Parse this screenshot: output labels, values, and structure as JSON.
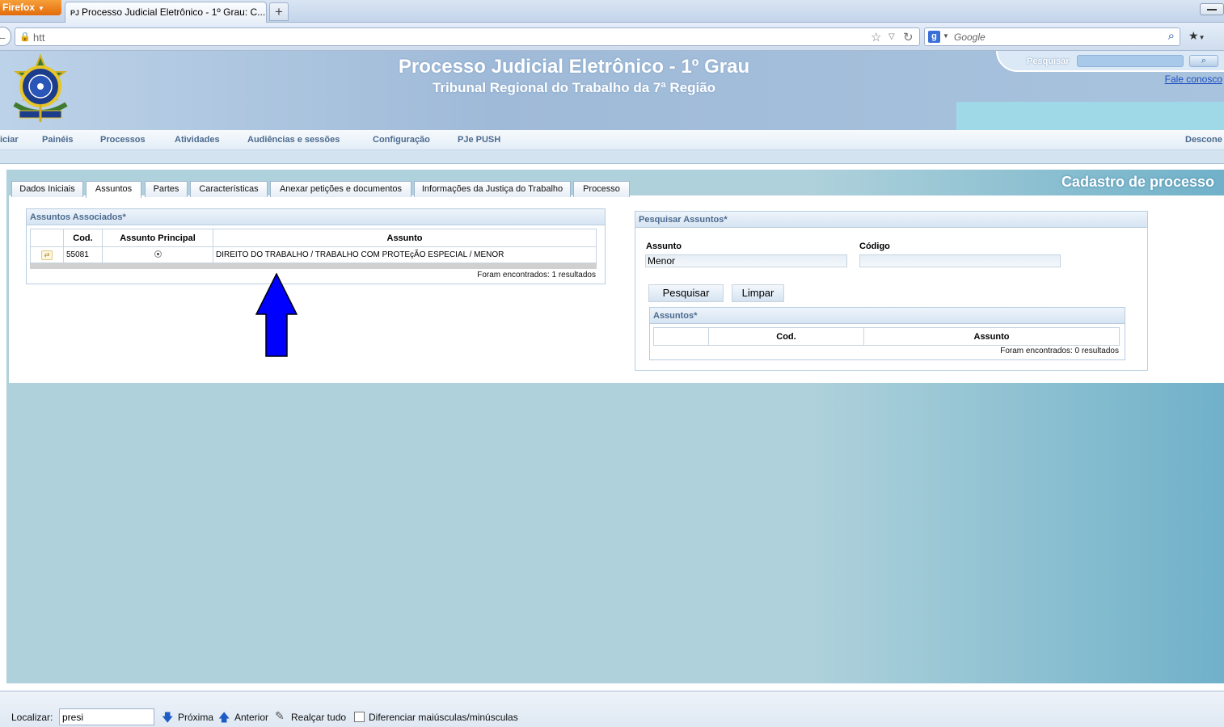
{
  "browser": {
    "app_button": "Firefox",
    "tab_title": "Processo Judicial Eletrônico - 1º Grau: C...",
    "tab_favicon": "PJ",
    "url": "htt",
    "search_placeholder": "Google"
  },
  "header": {
    "title": "Processo Judicial Eletrônico - 1º Grau",
    "subtitle": "Tribunal Regional do Trabalho da 7ª Região",
    "search_label": "Pesquisar",
    "contact_link": "Fale conosco"
  },
  "menu": {
    "items": [
      "iciar",
      "Painéis",
      "Processos",
      "Atividades",
      "Audiências e sessões",
      "Configuração",
      "PJe PUSH"
    ],
    "right_item": "Descone"
  },
  "page": {
    "heading": "Cadastro de processo",
    "tabs": [
      "Dados Iniciais",
      "Assuntos",
      "Partes",
      "Características",
      "Anexar petições e documentos",
      "Informações da Justiça do Trabalho",
      "Processo"
    ],
    "active_tab": "Assuntos"
  },
  "associated": {
    "title": "Assuntos Associados*",
    "columns": [
      "",
      "Cod.",
      "Assunto Principal",
      "Assunto"
    ],
    "rows": [
      {
        "cod": "55081",
        "assunto": "DIREITO DO TRABALHO / TRABALHO COM PROTEçÃO ESPECIAL / MENOR"
      }
    ],
    "found": "Foram encontrados: 1 resultados"
  },
  "search": {
    "title": "Pesquisar Assuntos*",
    "assunto_label": "Assunto",
    "assunto_value": "Menor",
    "codigo_label": "Código",
    "codigo_value": "",
    "search_button": "Pesquisar",
    "clear_button": "Limpar",
    "results_title": "Assuntos*",
    "results_columns": [
      "",
      "Cod.",
      "Assunto"
    ],
    "results_found": "Foram encontrados: 0 resultados"
  },
  "findbar": {
    "label": "Localizar:",
    "value": "presi",
    "next": "Próxima",
    "previous": "Anterior",
    "highlight": "Realçar tudo",
    "match_case": "Diferenciar maiúsculas/minúsculas"
  },
  "colors": {
    "annotation_arrow": "#0000ff",
    "menu_text": "#4b6a8e",
    "link": "#1d4ec2"
  }
}
